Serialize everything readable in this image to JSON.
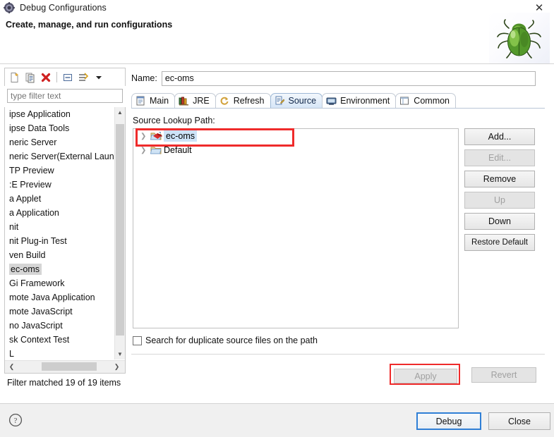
{
  "window": {
    "title": "Debug Configurations",
    "title_icon": "gear-icon",
    "close_label": "✕"
  },
  "header": {
    "title": "Create, manage, and run configurations",
    "decoration_icon": "green-bug-icon"
  },
  "left_panel": {
    "toolbar": [
      {
        "name": "new-configuration-icon",
        "tooltip": "New launch configuration"
      },
      {
        "name": "duplicate-configuration-icon",
        "tooltip": "Duplicate"
      },
      {
        "name": "delete-configuration-icon",
        "tooltip": "Delete"
      },
      {
        "name": "collapse-all-icon",
        "tooltip": "Collapse All"
      },
      {
        "name": "filter-launch-configurations-icon",
        "tooltip": "Filter"
      },
      {
        "name": "chevron-down-icon",
        "tooltip": "View Menu"
      }
    ],
    "filter": {
      "value": "",
      "placeholder": "type filter text"
    },
    "items": [
      {
        "label": "ipse Application",
        "selected": false
      },
      {
        "label": "ipse Data Tools",
        "selected": false
      },
      {
        "label": "neric Server",
        "selected": false
      },
      {
        "label": "neric Server(External Launc",
        "selected": false
      },
      {
        "label": "TP Preview",
        "selected": false
      },
      {
        "label": ":E Preview",
        "selected": false
      },
      {
        "label": "a Applet",
        "selected": false
      },
      {
        "label": "a Application",
        "selected": false
      },
      {
        "label": "nit",
        "selected": false
      },
      {
        "label": "nit Plug-in Test",
        "selected": false
      },
      {
        "label": "ven Build",
        "selected": false
      },
      {
        "label": "ec-oms",
        "selected": true
      },
      {
        "label": "Gi Framework",
        "selected": false
      },
      {
        "label": "mote Java Application",
        "selected": false
      },
      {
        "label": "mote JavaScript",
        "selected": false
      },
      {
        "label": "no JavaScript",
        "selected": false
      },
      {
        "label": "sk Context Test",
        "selected": false
      },
      {
        "label": "L",
        "selected": false
      }
    ],
    "status": "Filter matched 19 of 19 items"
  },
  "right_panel": {
    "name_label": "Name:",
    "name_value": "ec-oms",
    "tabs": [
      {
        "label": "Main",
        "icon": "document-icon",
        "active": false
      },
      {
        "label": "JRE",
        "icon": "books-icon",
        "active": false
      },
      {
        "label": "Refresh",
        "icon": "refresh-icon",
        "active": false
      },
      {
        "label": "Source",
        "icon": "source-icon",
        "active": true
      },
      {
        "label": "Environment",
        "icon": "environment-icon",
        "active": false
      },
      {
        "label": "Common",
        "icon": "common-icon",
        "active": false
      }
    ],
    "source_tab": {
      "lookup_path_label": "Source Lookup Path:",
      "tree": [
        {
          "label": "ec-oms",
          "icon": "project-folder-icon",
          "selected": true,
          "expandable": true,
          "highlighted": true
        },
        {
          "label": "Default",
          "icon": "folder-icon",
          "selected": false,
          "expandable": true,
          "highlighted": false
        }
      ],
      "buttons": [
        {
          "label": "Add...",
          "enabled": true
        },
        {
          "label": "Edit...",
          "enabled": false
        },
        {
          "label": "Remove",
          "enabled": true
        },
        {
          "label": "Up",
          "enabled": false
        },
        {
          "label": "Down",
          "enabled": true
        },
        {
          "label": "Restore Default",
          "enabled": true
        }
      ],
      "duplicate_checkbox": {
        "label": "Search for duplicate source files on the path",
        "checked": false
      }
    },
    "apply_label": "Apply",
    "apply_enabled": false,
    "revert_label": "Revert",
    "revert_enabled": false
  },
  "footer": {
    "help_icon": "help-icon",
    "debug_label": "Debug",
    "close_label": "Close"
  },
  "colors": {
    "annotation_red": "#ef2b2b",
    "default_button_border": "#2f7fd6",
    "selection_blue": "#cde3f7",
    "selection_gray": "#d5d5d5"
  }
}
